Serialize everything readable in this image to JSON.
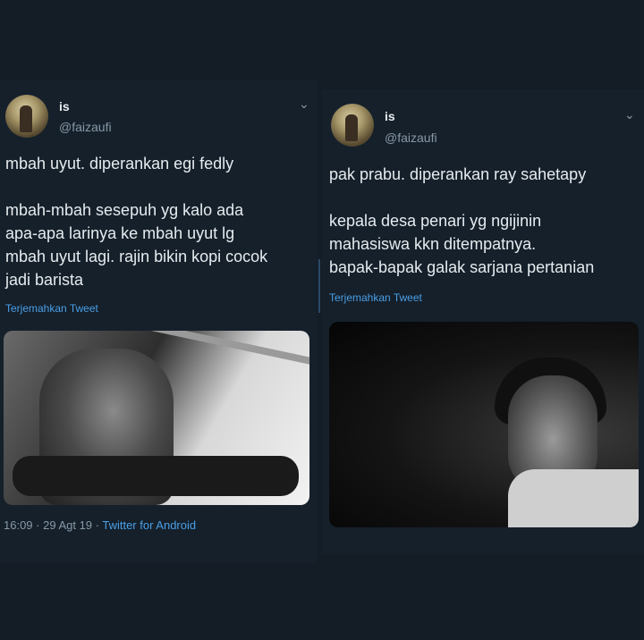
{
  "tweet_left": {
    "name": "is",
    "handle": "@faizaufi",
    "text": "mbah uyut. diperankan egi fedly\n\nmbah-mbah sesepuh yg kalo ada\napa-apa larinya ke mbah uyut lg\nmbah uyut lagi. rajin bikin kopi cocok\njadi barista",
    "translate_label": "Terjemahkan Tweet",
    "timestamp": "16:09 · 29 Agt 19 · ",
    "source": "Twitter for Android",
    "chevron_icon": "chevron-down-icon"
  },
  "tweet_right": {
    "name": "is",
    "handle": "@faizaufi",
    "text": "pak prabu. diperankan ray sahetapy\n\nkepala desa penari yg ngijinin\nmahasiswa kkn ditempatnya.\nbapak-bapak galak sarjana pertanian",
    "translate_label": "Terjemahkan Tweet",
    "chevron_icon": "chevron-down-icon"
  }
}
